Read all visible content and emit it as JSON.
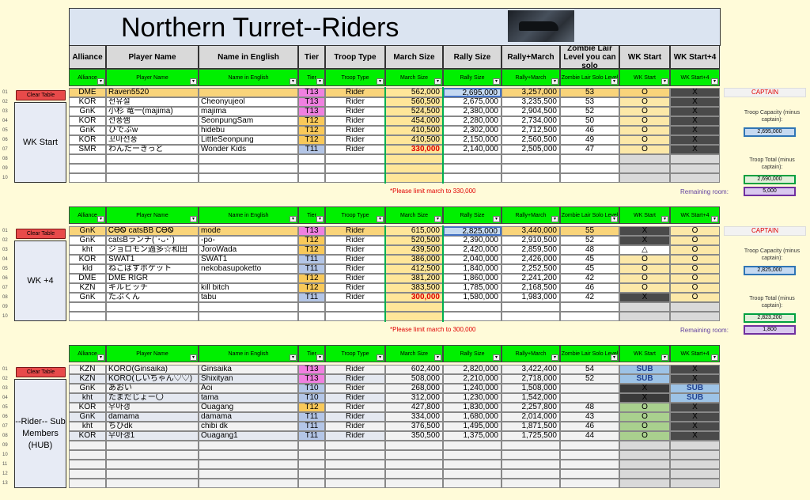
{
  "title": "Northern Turret--Riders",
  "header_main": [
    "Alliance",
    "Player Name",
    "Name in English",
    "Tier",
    "Troop Type",
    "March Size",
    "Rally Size",
    "Rally+March",
    "Zombie Lair Level you can solo",
    "WK Start",
    "WK Start+4"
  ],
  "header_filter": [
    "Alliance",
    "Player Name",
    "Name in English",
    "Tier",
    "Troop Type",
    "March Size",
    "Rally Size",
    "Rally+March",
    "Zombie Lair Solo Level",
    "WK Start",
    "WK Start+4"
  ],
  "clear_label": "Clear Table",
  "captain_label": "CAPTAIN",
  "troop_capacity_label": "Troop Capacity (minus captain):",
  "troop_total_label": "Troop Total (minus captain):",
  "remaining_label": "Remaining room:",
  "sections": [
    {
      "label": "WK Start",
      "row_numbers": [
        "01",
        "02",
        "03",
        "04",
        "05",
        "06",
        "07",
        "08",
        "09",
        "10"
      ],
      "rows": [
        [
          "DME",
          "Raven5520",
          "",
          "T13",
          "Rider",
          "562,000",
          "2,695,000",
          "3,257,000",
          "53",
          "O",
          "X"
        ],
        [
          "KOR",
          "천유절",
          "Cheonyujeol",
          "T13",
          "Rider",
          "560,500",
          "2,675,000",
          "3,235,500",
          "53",
          "O",
          "X"
        ],
        [
          "GnK",
          "小杉 竜一(majima)",
          "majima",
          "T13",
          "Rider",
          "524,500",
          "2,380,000",
          "2,904,500",
          "52",
          "O",
          "X"
        ],
        [
          "KOR",
          "선풍쌤",
          "SeonpungSam",
          "T12",
          "Rider",
          "454,000",
          "2,280,000",
          "2,734,000",
          "50",
          "O",
          "X"
        ],
        [
          "GnK",
          "ひでぶw",
          "hidebu",
          "T12",
          "Rider",
          "410,500",
          "2,302,000",
          "2,712,500",
          "46",
          "O",
          "X"
        ],
        [
          "KOR",
          "꼬마선풍",
          "LittleSeonpung",
          "T12",
          "Rider",
          "410,500",
          "2,150,000",
          "2,560,500",
          "49",
          "O",
          "X"
        ],
        [
          "SMR",
          "わんだーきっど",
          "Wonder Kids",
          "T11",
          "Rider",
          "330,000",
          "2,140,000",
          "2,505,000",
          "47",
          "O",
          "X"
        ]
      ],
      "note": "*Please limit march to 330,000",
      "capacity": "2,695,000",
      "total": "2,690,000",
      "remaining": "5,000"
    },
    {
      "label": "WK +4",
      "row_numbers": [
        "01",
        "02",
        "03",
        "04",
        "05",
        "06",
        "07",
        "08",
        "09",
        "10"
      ],
      "rows": [
        [
          "GnK",
          "ᏟᎾᏫ catsBB ᏟᎾᏫ",
          "mode",
          "T13",
          "Rider",
          "615,000",
          "2,825,000",
          "3,440,000",
          "55",
          "X",
          "O"
        ],
        [
          "GnK",
          "catsBランチ(`･ᴗ･´)",
          "-po-",
          "T12",
          "Rider",
          "520,500",
          "2,390,000",
          "2,910,500",
          "52",
          "X",
          "O"
        ],
        [
          "kht",
          "ジョロモン過多☆和田",
          "JoroWada",
          "T12",
          "Rider",
          "439,500",
          "2,420,000",
          "2,859,500",
          "48",
          "△",
          "O"
        ],
        [
          "KOR",
          "SWAT1",
          "SWAT1",
          "T11",
          "Rider",
          "386,000",
          "2,040,000",
          "2,426,000",
          "45",
          "O",
          "O"
        ],
        [
          "kld",
          "ねこばすポケット",
          "nekobasupoketto",
          "T11",
          "Rider",
          "412,500",
          "1,840,000",
          "2,252,500",
          "45",
          "O",
          "O"
        ],
        [
          "DME",
          "DME RIGR",
          "",
          "T12",
          "Rider",
          "381,200",
          "1,860,000",
          "2,241,200",
          "42",
          "O",
          "O"
        ],
        [
          "KZN",
          "キルビッチ",
          "kill bitch",
          "T12",
          "Rider",
          "383,500",
          "1,785,000",
          "2,168,500",
          "46",
          "O",
          "O"
        ],
        [
          "GnK",
          "たぶくん",
          "tabu",
          "T11",
          "Rider",
          "300,000",
          "1,580,000",
          "1,983,000",
          "42",
          "X",
          "O"
        ]
      ],
      "note": "*Please limit march to 300,000",
      "capacity": "2,825,000",
      "total": "2,823,200",
      "remaining": "1,800"
    },
    {
      "label": "--Rider-- Sub Members (HUB)",
      "row_numbers": [
        "01",
        "02",
        "03",
        "04",
        "05",
        "06",
        "07",
        "08",
        "09",
        "10",
        "11",
        "12",
        "13"
      ],
      "rows": [
        [
          "KZN",
          "KORO(Ginsaika)",
          "Ginsaika",
          "T13",
          "Rider",
          "602,400",
          "2,820,000",
          "3,422,400",
          "54",
          "SUB",
          "X"
        ],
        [
          "KZN",
          "KORO(しいちゃん♡♡)",
          "Shixityan",
          "T13",
          "Rider",
          "508,000",
          "2,210,000",
          "2,718,000",
          "52",
          "SUB",
          "X"
        ],
        [
          "GnK",
          "あおい",
          "Aoi",
          "T10",
          "Rider",
          "268,000",
          "1,240,000",
          "1,508,000",
          "",
          "X",
          "SUB"
        ],
        [
          "kht",
          "たまだじょー〇",
          "tama",
          "T10",
          "Rider",
          "312,000",
          "1,230,000",
          "1,542,000",
          "",
          "X",
          "SUB"
        ],
        [
          "KOR",
          "우아갱",
          "Ouagang",
          "T12",
          "Rider",
          "427,800",
          "1,830,000",
          "2,257,800",
          "48",
          "O",
          "X"
        ],
        [
          "GnK",
          "damama",
          "damama",
          "T11",
          "Rider",
          "334,000",
          "1,680,000",
          "2,014,000",
          "43",
          "O",
          "X"
        ],
        [
          "kht",
          "ちびdk",
          "chibi dk",
          "T11",
          "Rider",
          "376,500",
          "1,495,000",
          "1,871,500",
          "46",
          "O",
          "X"
        ],
        [
          "KOR",
          "우아갱1",
          "Ouagang1",
          "T11",
          "Rider",
          "350,500",
          "1,375,000",
          "1,725,500",
          "44",
          "O",
          "X"
        ]
      ]
    }
  ],
  "colors": {
    "background": "#fffbd9",
    "filter_header": "#00f000",
    "tier_t13": "#f080e0",
    "tier_t12": "#f9c95a",
    "tier_t11": "#b4c6e7",
    "march_col": "#ffe699",
    "march_limit_text": "#e00000",
    "captain_row": "#f9d47a",
    "wk_start_col": "#fce8a8",
    "dark_x": "#3a3a3a",
    "sub_badge": "#9dc3e6",
    "green_o": "#a9d08e"
  }
}
